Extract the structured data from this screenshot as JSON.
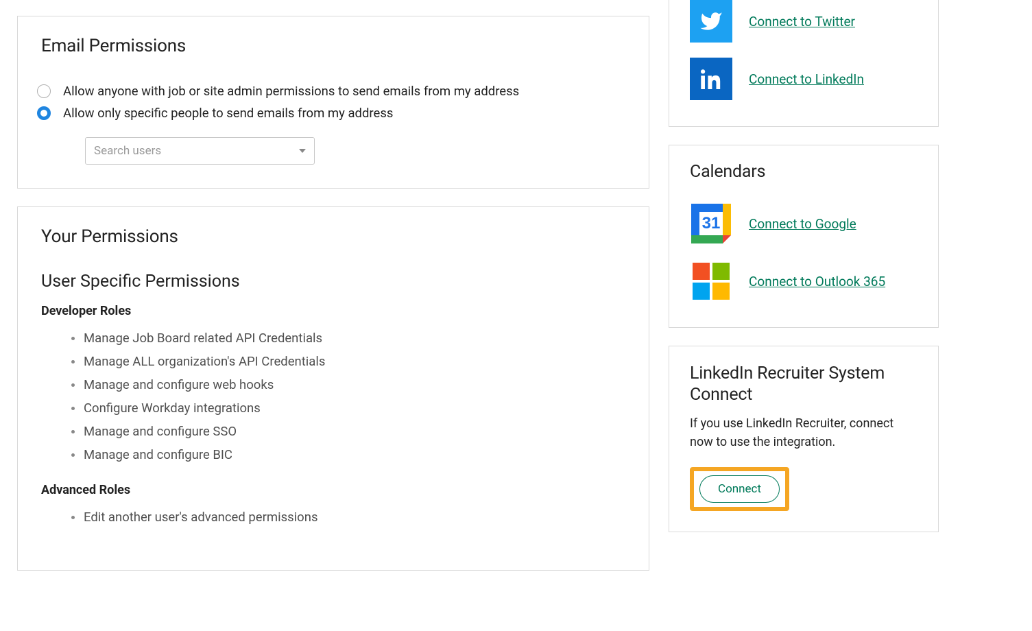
{
  "emailPermissions": {
    "title": "Email Permissions",
    "options": [
      {
        "label": "Allow anyone with job or site admin permissions to send emails from my address",
        "checked": false
      },
      {
        "label": "Allow only specific people to send emails from my address",
        "checked": true
      }
    ],
    "searchPlaceholder": "Search users"
  },
  "yourPermissions": {
    "title": "Your Permissions",
    "userSpecificTitle": "User Specific Permissions",
    "developerRolesHeading": "Developer Roles",
    "developerRoles": [
      "Manage Job Board related API Credentials",
      "Manage ALL organization's API Credentials",
      "Manage and configure web hooks",
      "Configure Workday integrations",
      "Manage and configure SSO",
      "Manage and configure BIC"
    ],
    "advancedRolesHeading": "Advanced Roles",
    "advancedRoles": [
      "Edit another user's advanced permissions"
    ]
  },
  "social": {
    "twitter": {
      "label": "Connect to Twitter"
    },
    "linkedin": {
      "label": "Connect to LinkedIn"
    }
  },
  "calendars": {
    "title": "Calendars",
    "google": {
      "label": "Connect to Google"
    },
    "outlook": {
      "label": "Connect to Outlook 365",
      "day": "31"
    }
  },
  "lrsc": {
    "title": "LinkedIn Recruiter System Connect",
    "desc": "If you use LinkedIn Recruiter, connect now to use the integration.",
    "button": "Connect"
  }
}
